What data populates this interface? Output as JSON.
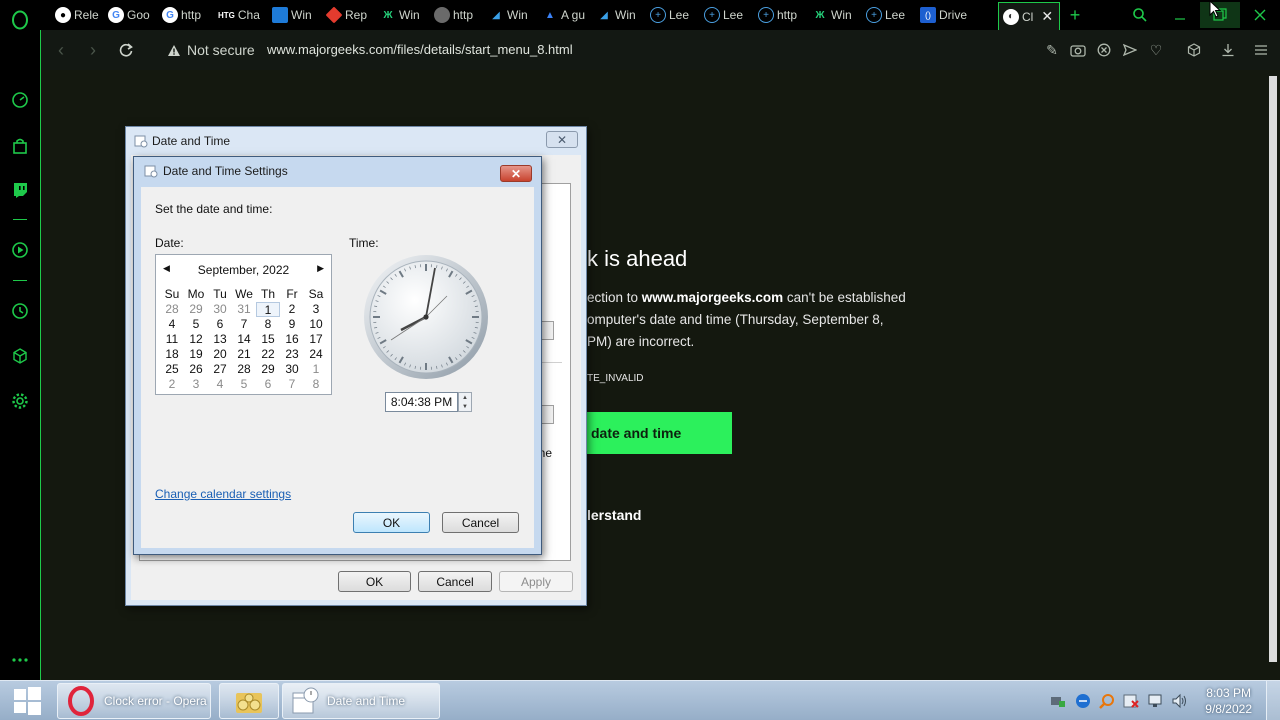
{
  "browser": {
    "tabs": [
      {
        "label": "Rele",
        "icon": "github-icon"
      },
      {
        "label": "Goo",
        "icon": "google-icon"
      },
      {
        "label": "http",
        "icon": "google-icon"
      },
      {
        "label": "Cha",
        "icon": "htg-icon",
        "badge": "HTG"
      },
      {
        "label": "Win",
        "icon": "windows-icon"
      },
      {
        "label": "Rep",
        "icon": "diamond-icon"
      },
      {
        "label": "Win",
        "icon": "winaero-icon"
      },
      {
        "label": "http",
        "icon": "globe-dark-icon"
      },
      {
        "label": "Win",
        "icon": "bird-icon"
      },
      {
        "label": "A gu",
        "icon": "arch-icon"
      },
      {
        "label": "Win",
        "icon": "bird-icon"
      },
      {
        "label": "Lee",
        "icon": "globe-icon"
      },
      {
        "label": "Lee",
        "icon": "globe-icon"
      },
      {
        "label": "http",
        "icon": "globe-icon"
      },
      {
        "label": "Win",
        "icon": "winaero-icon"
      },
      {
        "label": "Lee",
        "icon": "globe-icon"
      },
      {
        "label": "Drive",
        "icon": "drive-icon"
      },
      {
        "label": "Cl",
        "icon": "globe-icon",
        "active": true
      }
    ],
    "security_label": "Not secure",
    "url": "www.majorgeeks.com/files/details/start_menu_8.html"
  },
  "page": {
    "title_fragment": "k is ahead",
    "line1_pre": "ection to ",
    "line1_host": "www.majorgeeks.com",
    "line1_post": " can't be established",
    "line2": "omputer's date and time (Thursday, September 8,",
    "line3": " PM) are incorrect.",
    "error_code": "TE_INVALID",
    "fix_button": "date and time",
    "understand_link": "lerstand",
    "fragment_ne": "ne"
  },
  "dialog_outer": {
    "title": "Date and Time",
    "ok": "OK",
    "cancel": "Cancel",
    "apply": "Apply"
  },
  "dialog_inner": {
    "title": "Date and Time Settings",
    "instruction": "Set the date and time:",
    "date_label": "Date:",
    "time_label": "Time:",
    "calendar_month": "September, 2022",
    "weekdays": [
      "Su",
      "Mo",
      "Tu",
      "We",
      "Th",
      "Fr",
      "Sa"
    ],
    "calendar_days": [
      [
        "28",
        "29",
        "30",
        "31",
        "1",
        "2",
        "3"
      ],
      [
        "4",
        "5",
        "6",
        "7",
        "8",
        "9",
        "10"
      ],
      [
        "11",
        "12",
        "13",
        "14",
        "15",
        "16",
        "17"
      ],
      [
        "18",
        "19",
        "20",
        "21",
        "22",
        "23",
        "24"
      ],
      [
        "25",
        "26",
        "27",
        "28",
        "29",
        "30",
        "1"
      ],
      [
        "2",
        "3",
        "4",
        "5",
        "6",
        "7",
        "8"
      ]
    ],
    "selected_day": "1",
    "time_value": "8:04:38 PM",
    "change_calendar_link": "Change calendar settings",
    "ok": "OK",
    "cancel": "Cancel"
  },
  "taskbar": {
    "items": [
      {
        "label": "Clock error - Opera",
        "icon": "opera-icon"
      },
      {
        "label": "",
        "icon": "explorer-icon"
      },
      {
        "label": "Date and Time",
        "icon": "calendar-icon"
      }
    ],
    "time": "8:03 PM",
    "date": "9/8/2022"
  },
  "colors": {
    "accent": "#1ec94a",
    "button_green": "#2cf05c",
    "link_blue": "#1a5fb4"
  }
}
